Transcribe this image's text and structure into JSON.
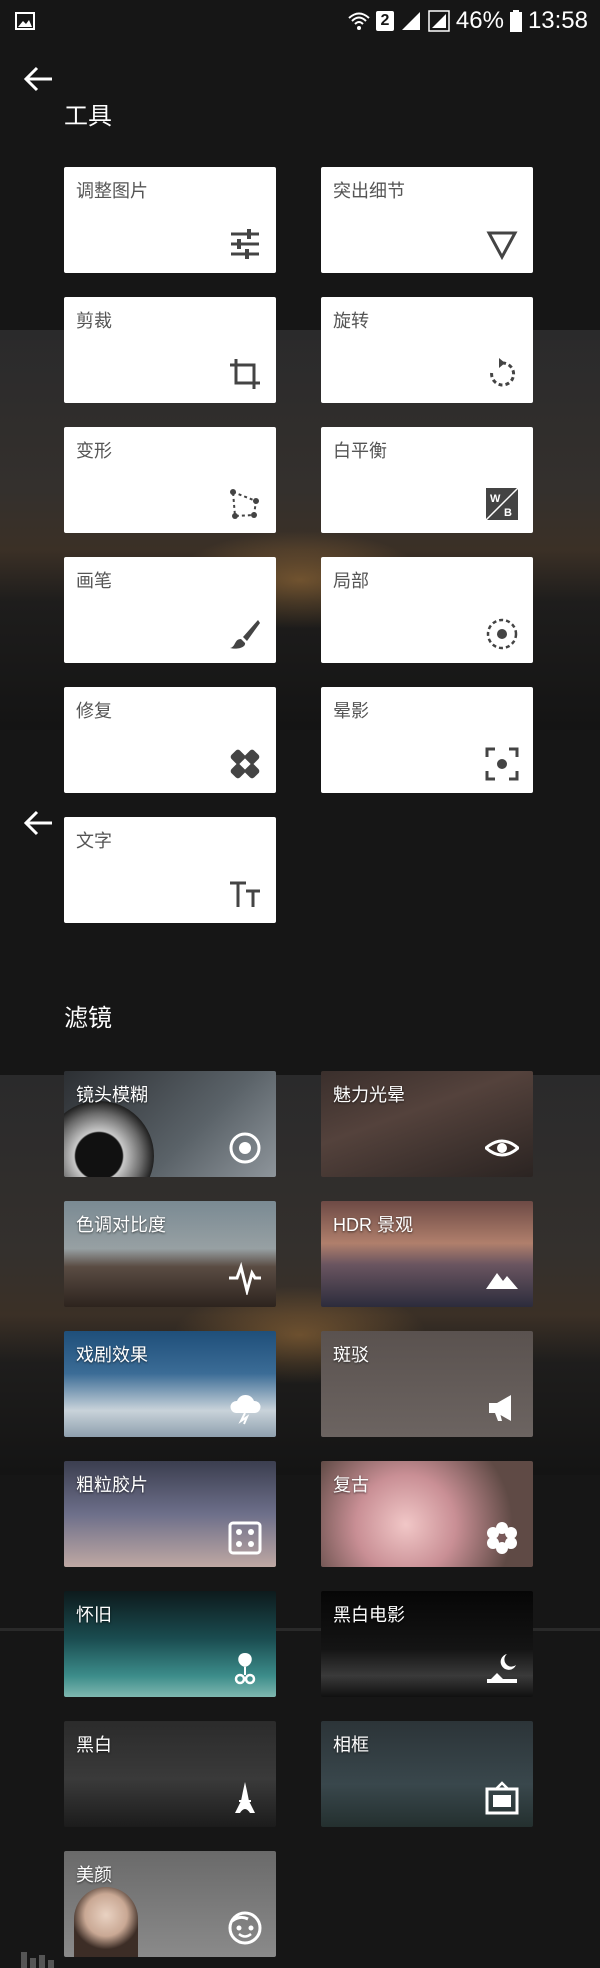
{
  "status_bar": {
    "sim_slot": "2",
    "battery": "46%",
    "time": "13:58"
  },
  "tools": {
    "title": "工具",
    "items": [
      {
        "label": "调整图片",
        "icon": "tune-sliders-icon"
      },
      {
        "label": "突出细节",
        "icon": "triangle-down-icon"
      },
      {
        "label": "剪裁",
        "icon": "crop-icon"
      },
      {
        "label": "旋转",
        "icon": "rotate-icon"
      },
      {
        "label": "变形",
        "icon": "perspective-icon"
      },
      {
        "label": "白平衡",
        "icon": "white-balance-icon"
      },
      {
        "label": "画笔",
        "icon": "brush-icon"
      },
      {
        "label": "局部",
        "icon": "selective-icon"
      },
      {
        "label": "修复",
        "icon": "healing-icon"
      },
      {
        "label": "晕影",
        "icon": "vignette-icon"
      },
      {
        "label": "文字",
        "icon": "text-icon",
        "icon_text": "TT"
      }
    ]
  },
  "filters": {
    "title": "滤镜",
    "items": [
      {
        "label": "镜头模糊",
        "icon": "lens-blur-icon"
      },
      {
        "label": "魅力光晕",
        "icon": "eye-icon"
      },
      {
        "label": "色调对比度",
        "icon": "pulse-icon"
      },
      {
        "label": "HDR 景观",
        "icon": "mountain-icon"
      },
      {
        "label": "戏剧效果",
        "icon": "cloud-icon"
      },
      {
        "label": "斑驳",
        "icon": "megaphone-icon"
      },
      {
        "label": "粗粒胶片",
        "icon": "dice-icon"
      },
      {
        "label": "复古",
        "icon": "flower-icon"
      },
      {
        "label": "怀旧",
        "icon": "tree-icon"
      },
      {
        "label": "黑白电影",
        "icon": "moon-icon"
      },
      {
        "label": "黑白",
        "icon": "eiffel-tower-icon"
      },
      {
        "label": "相框",
        "icon": "frame-icon"
      },
      {
        "label": "美颜",
        "icon": "face-icon"
      }
    ]
  }
}
